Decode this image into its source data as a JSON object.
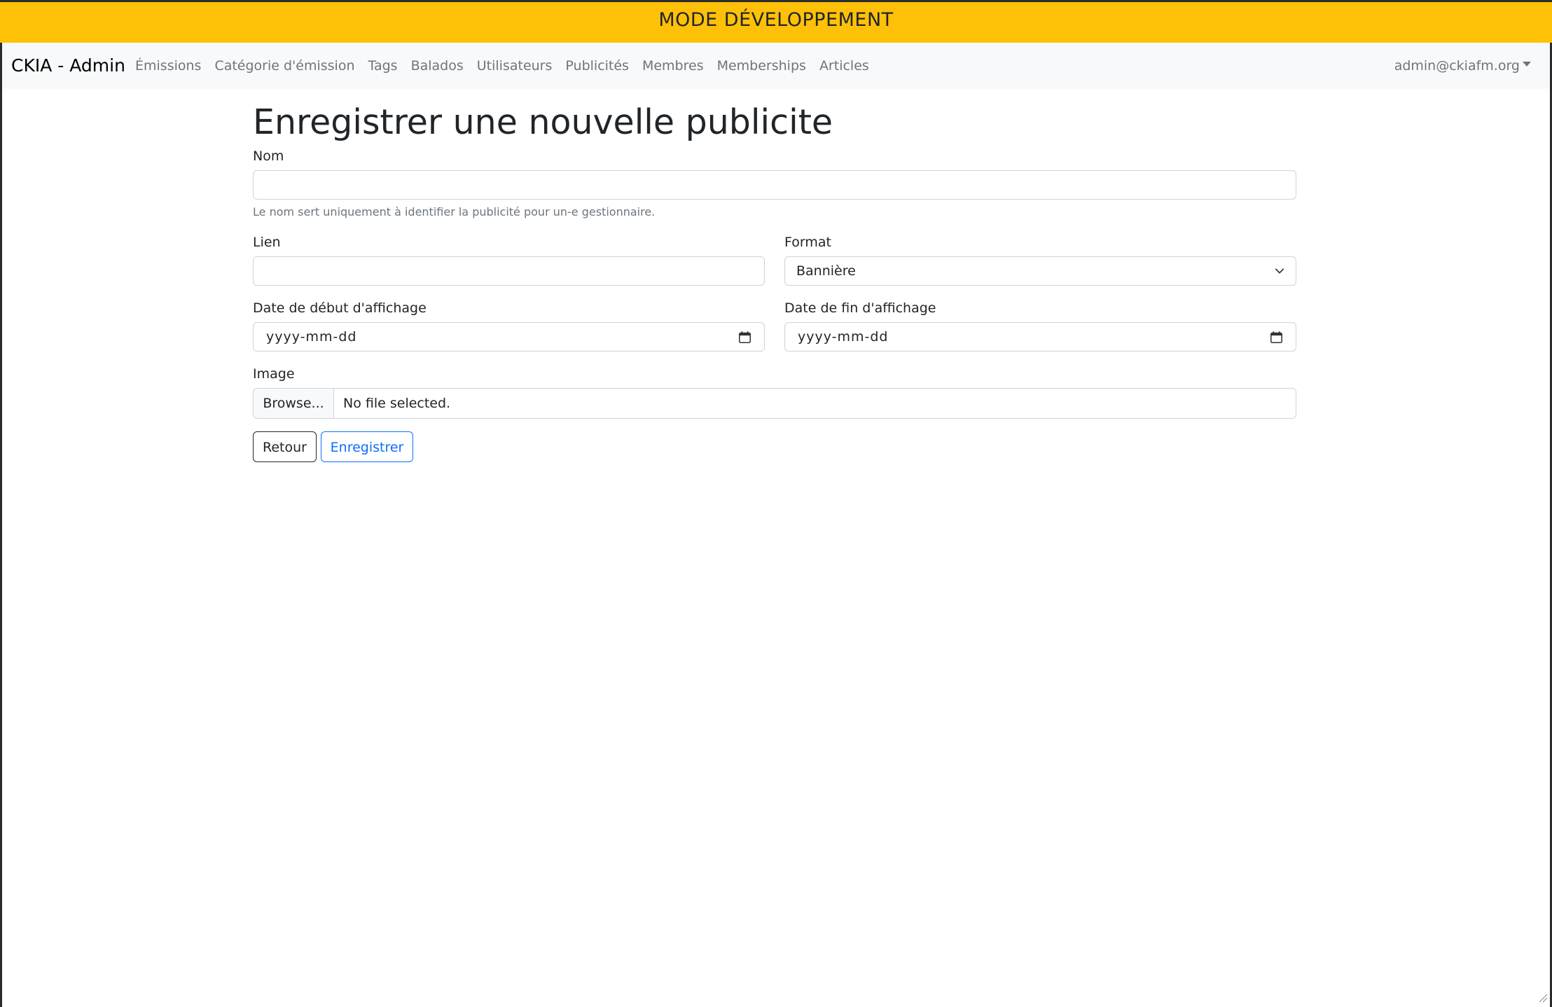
{
  "dev_banner": {
    "text": "MODE DÉVELOPPEMENT"
  },
  "navbar": {
    "brand": "CKIA - Admin",
    "links": [
      {
        "label": "Émissions"
      },
      {
        "label": "Catégorie d'émission"
      },
      {
        "label": "Tags"
      },
      {
        "label": "Balados"
      },
      {
        "label": "Utilisateurs"
      },
      {
        "label": "Publicités"
      },
      {
        "label": "Membres"
      },
      {
        "label": "Memberships"
      },
      {
        "label": "Articles"
      }
    ],
    "user_email": "admin@ckiafm.org"
  },
  "page": {
    "title": "Enregistrer une nouvelle publicite"
  },
  "form": {
    "nom": {
      "label": "Nom",
      "value": "",
      "help": "Le nom sert uniquement à identifier la publicité pour un-e gestionnaire."
    },
    "lien": {
      "label": "Lien",
      "value": ""
    },
    "format": {
      "label": "Format",
      "selected": "Bannière"
    },
    "date_debut": {
      "label": "Date de début d'affichage",
      "placeholder": "yyyy-mm-dd"
    },
    "date_fin": {
      "label": "Date de fin d'affichage",
      "placeholder": "yyyy-mm-dd"
    },
    "image": {
      "label": "Image",
      "browse_label": "Browse...",
      "status": "No file selected."
    },
    "buttons": {
      "back_label": "Retour",
      "save_label": "Enregistrer"
    }
  },
  "colors": {
    "dev_banner_bg": "#ffc107",
    "navbar_bg": "#f8f9fa",
    "primary": "#0d6efd",
    "muted": "#6c757d"
  },
  "icons": [
    "chevron-down-icon",
    "calendar-icon",
    "caret-down-icon",
    "resize-grip-icon"
  ]
}
